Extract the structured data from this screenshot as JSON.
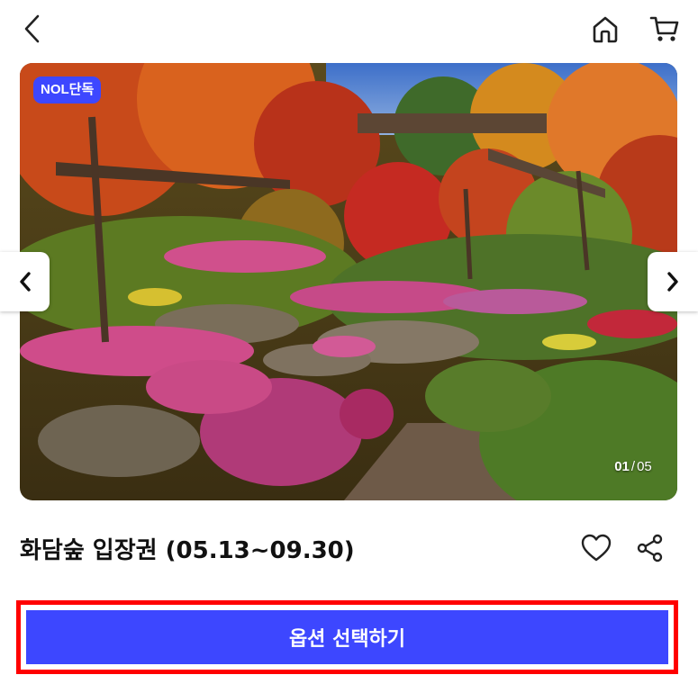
{
  "header": {
    "back_icon": "chevron-left-icon",
    "home_icon": "home-icon",
    "cart_icon": "cart-icon"
  },
  "gallery": {
    "badge": "NOL단독",
    "current": "01",
    "separator": "/",
    "total": "05",
    "prev_icon": "chevron-left-icon",
    "next_icon": "chevron-right-icon"
  },
  "product": {
    "title": "화담숲 입장권 (05.13~09.30)",
    "wishlist_icon": "heart-icon",
    "share_icon": "share-icon"
  },
  "cta": {
    "label": "옵션 선택하기"
  },
  "colors": {
    "accent": "#3d47ff",
    "highlight": "#ff0000"
  }
}
